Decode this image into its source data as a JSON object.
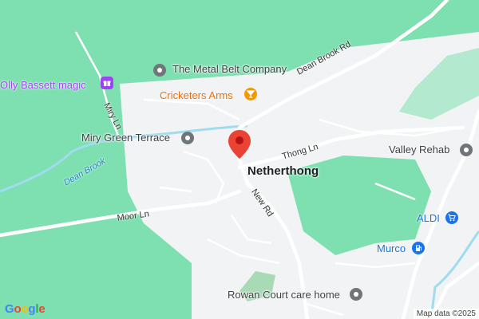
{
  "map": {
    "colors": {
      "green": "#7ee0b0",
      "urban": "#f1f3f4",
      "road": "#ffffff",
      "water": "#9fdcf0",
      "marker": "#ea4335"
    },
    "places": {
      "town": "Netherthong",
      "metal_belt": "The Metal Belt Company",
      "cricketers": "Cricketers Arms",
      "olly": "Olly Bassett magic",
      "miry_green": "Miry Green Terrace",
      "valley_rehab": "Valley Rehab",
      "aldi": "ALDI",
      "murco": "Murco",
      "rowan": "Rowan Court care home"
    },
    "roads": {
      "dean_brook_rd": "Dean Brook Rd",
      "miry_ln": "Miry Ln",
      "thong_ln": "Thong Ln",
      "new_rd": "New Rd",
      "moor_ln": "Moor Ln"
    },
    "water": {
      "dean_brook": "Dean Brook"
    },
    "icons": {
      "marker": "red-location-marker",
      "poi": "place-pin-icon",
      "food": "cocktail-icon",
      "shop": "shopping-cart-icon",
      "fuel": "fuel-icon",
      "gift": "gift-icon"
    },
    "logo": "Google",
    "attribution": "Map data ©2025"
  }
}
